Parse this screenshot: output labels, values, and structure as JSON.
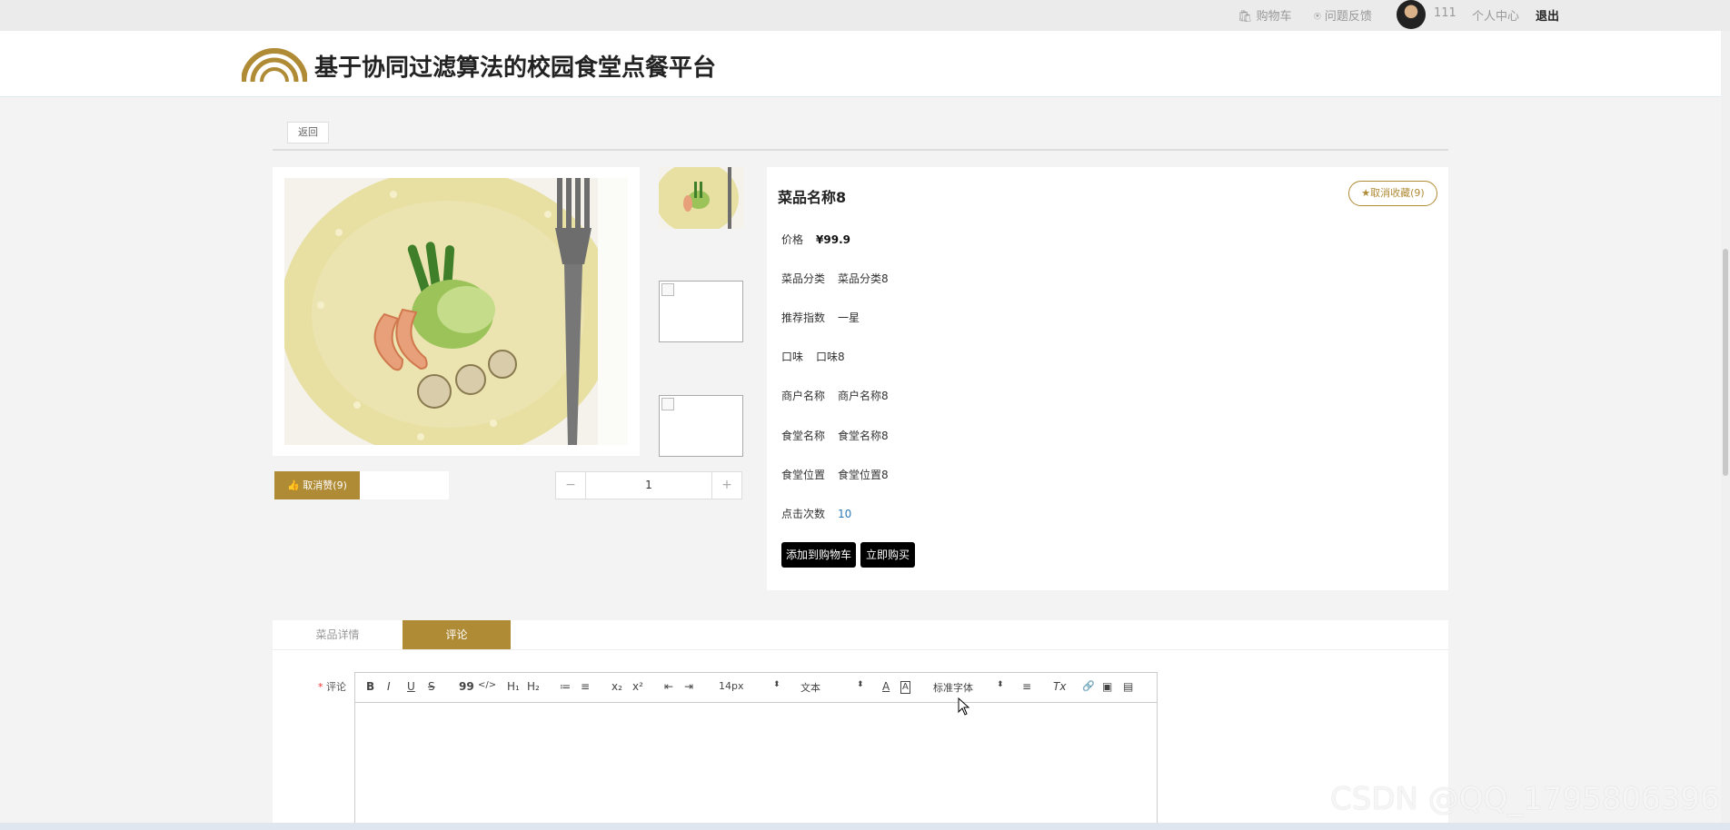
{
  "topbar": {
    "cart": "🛍 购物车",
    "feedback": "⍟ 问题反馈",
    "username": "111",
    "profile": "个人中心",
    "logout": "退出"
  },
  "header": {
    "title": "基于协同过滤算法的校园食堂点餐平台"
  },
  "back_label": "返回",
  "product": {
    "name": "菜品名称8",
    "favorite_label": "★取消收藏(9)",
    "like_label": "👍 取消赞(9)",
    "quantity": "1",
    "minus": "−",
    "plus": "+",
    "fields": {
      "price_label": "价格",
      "price_value": "¥99.9",
      "category_label": "菜品分类",
      "category_value": "菜品分类8",
      "rating_label": "推荐指数",
      "rating_value": "一星",
      "taste_label": "口味",
      "taste_value": "口味8",
      "merchant_label": "商户名称",
      "merchant_value": "商户名称8",
      "canteen_label": "食堂名称",
      "canteen_value": "食堂名称8",
      "location_label": "食堂位置",
      "location_value": "食堂位置8",
      "clicks_label": "点击次数",
      "clicks_value": "10"
    },
    "add_to_cart": "添加到购物车",
    "buy_now": "立即购买"
  },
  "tabs": {
    "detail": "菜品详情",
    "comment": "评论"
  },
  "comment": {
    "required_mark": "*",
    "label": "评论",
    "toolbar": {
      "bold": "B",
      "italic": "I",
      "underline": "U",
      "strike": "S",
      "quote": "99",
      "code": "</>",
      "h1": "H₁",
      "h2": "H₂",
      "ol": "≔",
      "ul": "≡",
      "sub": "x₂",
      "sup": "x²",
      "outdent": "⇤",
      "indent": "⇥",
      "size": "14px",
      "format": "文本",
      "color": "A",
      "bg": "A",
      "font": "标准字体",
      "align": "≡",
      "clean": "Tx",
      "link": "🔗",
      "image": "▣",
      "video": "▤",
      "arrow": "⬍"
    }
  },
  "watermark": "CSDN @QQ_1795806396",
  "colors": {
    "accent": "#b08b36",
    "dark_button": "#000000"
  }
}
